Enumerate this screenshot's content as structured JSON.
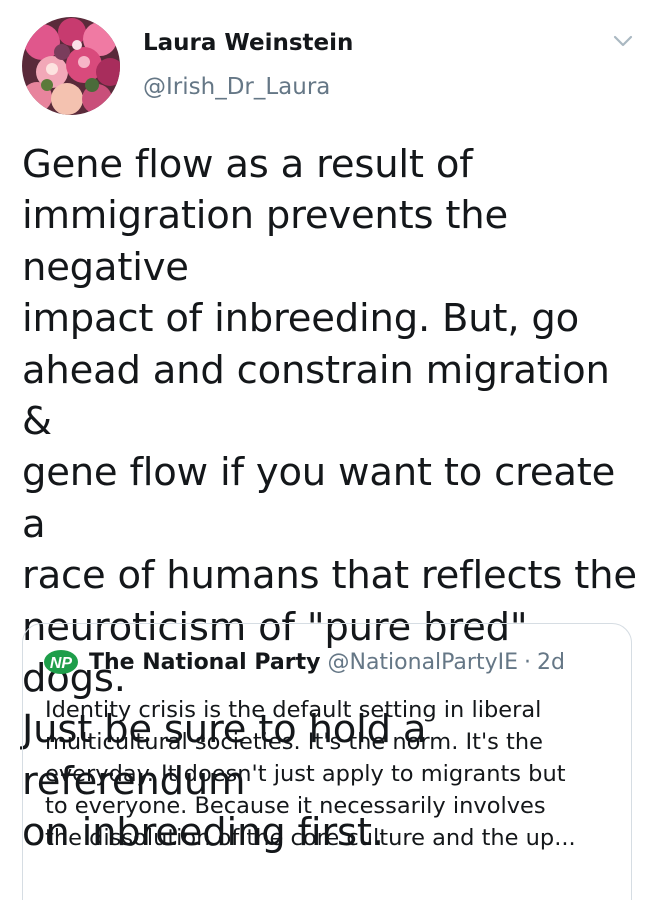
{
  "tweet": {
    "author_name": "Laura Weinstein",
    "author_handle": "@Irish_Dr_Laura",
    "avatar_icon": "flower-bouquet-avatar",
    "menu_icon": "chevron-down-icon",
    "text": "Gene flow as a result of\nimmigration prevents the negative\nimpact of inbreeding. But, go\nahead and constrain migration &\ngene flow if you want to create a\nrace of humans that reflects the\nneuroticism of \"pure bred\" dogs.\nJust be sure to hold a referendum\non inbreeding first."
  },
  "quoted_tweet": {
    "logo_text": "NP",
    "logo_color": "#1e9e4a",
    "author_name": "The National Party",
    "author_handle": "@NationalPartyIE",
    "separator": "·",
    "timestamp": "2d",
    "text": "Identity crisis is the default setting in liberal\nmulticultural societies. It's the norm. It's the\neveryday. It doesn't just apply to migrants but\nto everyone. Because it necessarily involves\nthe dissolution of the core culture and the up..."
  },
  "colors": {
    "text_primary": "#14171a",
    "text_secondary": "#657786",
    "border": "#d6dde3"
  }
}
